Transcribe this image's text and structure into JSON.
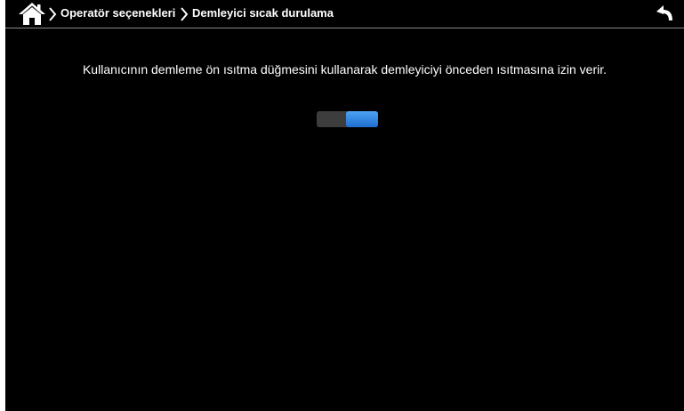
{
  "header": {
    "home_icon": "home-icon",
    "breadcrumb_separator_icon": "chevron-right-icon",
    "breadcrumbs": [
      "Operatör seçenekleri",
      "Demleyici sıcak durulama"
    ],
    "back_icon": "undo-arrow-icon"
  },
  "main": {
    "description": "Kullanıcının demleme ön ısıtma düğmesini kullanarak demleyiciyi önceden ısıtmasına izin verir.",
    "toggle": {
      "state": "on",
      "on_color": "#2f86e6",
      "off_color": "#3d3d3d"
    }
  },
  "colors": {
    "background": "#000000",
    "text": "#ffffff",
    "divider": "#8a8a8a",
    "accent": "#2f86e6"
  }
}
